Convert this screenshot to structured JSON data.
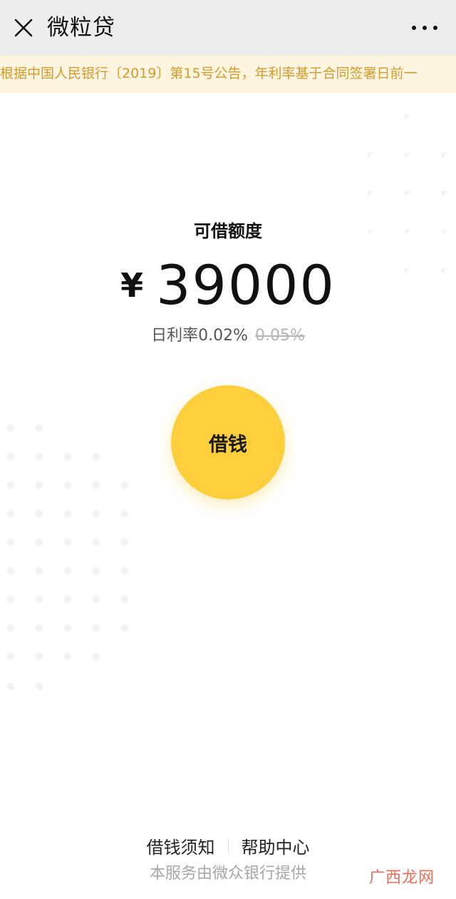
{
  "header": {
    "title": "微粒贷",
    "close_icon": "close-icon",
    "more_icon": "more-dots-icon"
  },
  "notice": {
    "text": "根据中国人民银行〔2019〕第15号公告，年利率基于合同签署日前一"
  },
  "main": {
    "limit_label": "可借额度",
    "currency_symbol": "¥",
    "amount": "39000",
    "rate_label": "日利率0.02%",
    "rate_old": "0.05%",
    "borrow_button": "借钱"
  },
  "footer": {
    "link_notice": "借钱须知",
    "link_help": "帮助中心",
    "provider": "本服务由微众银行提供"
  },
  "watermark": "广西龙网",
  "colors": {
    "accent": "#fdcf3c",
    "notice_bg": "#fdf5e0",
    "notice_text": "#d39b2f",
    "header_bg": "#ededed"
  }
}
